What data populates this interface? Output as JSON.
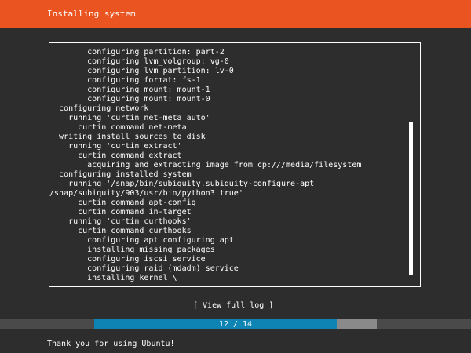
{
  "colors": {
    "header_bg": "#e95420",
    "background": "#2d2d2d",
    "progress_fill": "#0e84b5",
    "progress_track": "#8a8a8a"
  },
  "header": {
    "title": "Installing system"
  },
  "log": {
    "lines": [
      "        configuring partition: part-2",
      "        configuring lvm_volgroup: vg-0",
      "        configuring lvm_partition: lv-0",
      "        configuring format: fs-1",
      "        configuring mount: mount-1",
      "        configuring mount: mount-0",
      "  configuring network",
      "    running 'curtin net-meta auto'",
      "      curtin command net-meta",
      "  writing install sources to disk",
      "    running 'curtin extract'",
      "      curtin command extract",
      "        acquiring and extracting image from cp:///media/filesystem",
      "  configuring installed system",
      "    running '/snap/bin/subiquity.subiquity-configure-apt",
      "/snap/subiquity/903/usr/bin/python3 true'",
      "      curtin command apt-config",
      "      curtin command in-target",
      "    running 'curtin curthooks'",
      "      curtin command curthooks",
      "        configuring apt configuring apt",
      "        installing missing packages",
      "        configuring iscsi service",
      "        configuring raid (mdadm) service",
      "        installing kernel \\"
    ],
    "scroll_position": 0.32,
    "scroll_visible_fraction": 0.64
  },
  "view_log_button": {
    "label": "[ View full log ]"
  },
  "progress": {
    "current": 12,
    "total": 14,
    "label": "12 / 14"
  },
  "footer": {
    "message": "Thank you for using Ubuntu!"
  }
}
